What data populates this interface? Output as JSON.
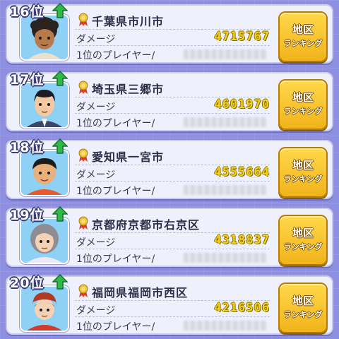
{
  "rankings": [
    {
      "rank": "16位",
      "city": "千葉県市川市",
      "damage_label": "ダメージ",
      "damage": "4715767",
      "player_label": "1位のプレイヤー/",
      "player_name": "",
      "button_line1": "地区",
      "button_line2": "ランキング",
      "avatar": "boy-curly-dark"
    },
    {
      "rank": "17位",
      "city": "埼玉県三郷市",
      "damage_label": "ダメージ",
      "damage": "4601970",
      "player_label": "1位のプレイヤー/",
      "player_name": "",
      "button_line1": "地区",
      "button_line2": "ランキング",
      "avatar": "man-black-hair"
    },
    {
      "rank": "18位",
      "city": "愛知県一宮市",
      "damage_label": "ダメージ",
      "damage": "4555664",
      "player_label": "1位のプレイヤー/",
      "player_name": "",
      "button_line1": "地区",
      "button_line2": "ランキング",
      "avatar": "boy-round"
    },
    {
      "rank": "19位",
      "city": "京都府京都市右京区",
      "damage_label": "ダメージ",
      "damage": "4318837",
      "player_label": "1位のプレイヤー/",
      "player_name": "",
      "button_line1": "地区",
      "button_line2": "ランキング",
      "avatar": "woman-gray-hair"
    },
    {
      "rank": "20位",
      "city": "福岡県福岡市西区",
      "damage_label": "ダメージ",
      "damage": "4216506",
      "player_label": "1位のプレイヤー/",
      "player_name": "",
      "button_line1": "地区",
      "button_line2": "ランキング",
      "avatar": "boy-red-cap"
    }
  ],
  "colors": {
    "background": "#8e8fe0",
    "damage_value": "#f2d21a",
    "button": "#f0b31a",
    "rank_up_arrow": "#2fb84a"
  }
}
